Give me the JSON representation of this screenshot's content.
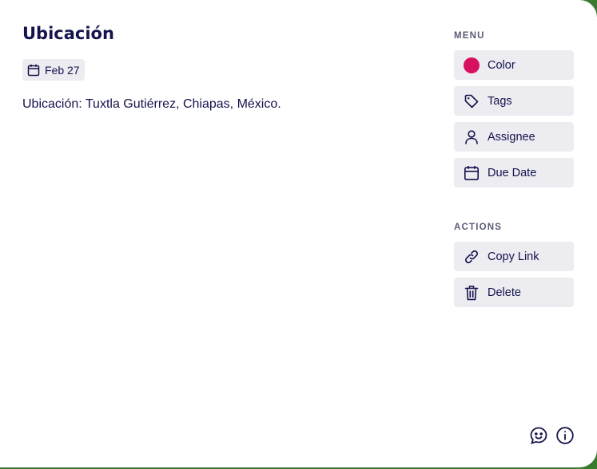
{
  "card": {
    "title": "Ubicación",
    "date": "Feb 27",
    "description": "Ubicación: Tuxtla Gutiérrez, Chiapas, México."
  },
  "menu": {
    "label": "MENU",
    "items": [
      {
        "label": "Color",
        "icon": "color-dot",
        "color": "#d6115f"
      },
      {
        "label": "Tags",
        "icon": "tag-icon"
      },
      {
        "label": "Assignee",
        "icon": "user-icon"
      },
      {
        "label": "Due Date",
        "icon": "calendar-icon"
      }
    ]
  },
  "actions": {
    "label": "ACTIONS",
    "items": [
      {
        "label": "Copy Link",
        "icon": "link-icon"
      },
      {
        "label": "Delete",
        "icon": "trash-icon"
      }
    ]
  },
  "footer": {
    "icons": [
      "feedback-icon",
      "info-icon"
    ]
  },
  "colors": {
    "text": "#14134d",
    "button_bg": "#ececf1",
    "accent": "#d6115f"
  }
}
